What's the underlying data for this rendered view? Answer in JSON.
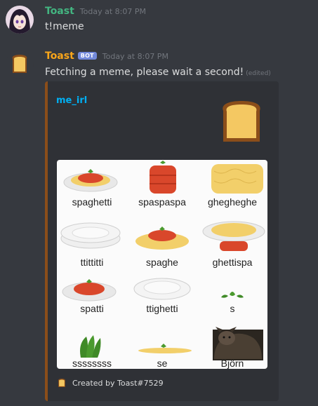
{
  "messages": [
    {
      "username": "Toast",
      "username_color": "#43b581",
      "timestamp": "Today at 8:07 PM",
      "text": "t!meme"
    },
    {
      "username": "Toast",
      "username_color": "#faa61a",
      "bot_tag": "BOT",
      "timestamp": "Today at 8:07 PM",
      "text": "Fetching a meme, please wait a second!",
      "edited": "(edited)"
    }
  ],
  "embed": {
    "title": "me_irl",
    "border_color": "#8b4e1a",
    "footer": "Created by Toast#7529",
    "meme_labels": [
      "spaghetti",
      "spaspaspa",
      "ghegheghe",
      "ttittitti",
      "spaghe",
      "ghettispa",
      "spatti",
      "ttighetti",
      "s",
      "ssssssss",
      "se",
      "Björn"
    ]
  }
}
